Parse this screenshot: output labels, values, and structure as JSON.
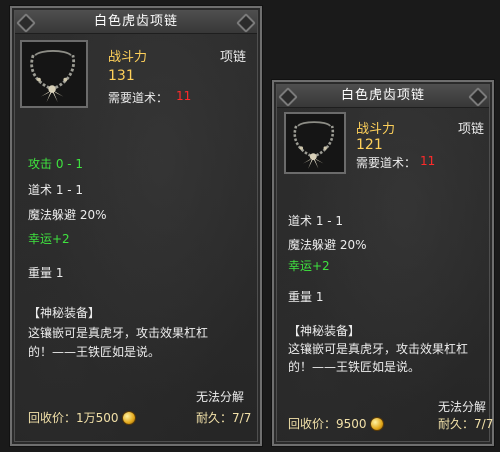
{
  "panel_left": {
    "title": "白色虎齿项链",
    "power_label": "战斗力",
    "power_value": "131",
    "item_type": "项链",
    "req_label": "需要道术：",
    "req_value": "11",
    "stats": {
      "attack": "攻击 0 - 1",
      "taoism": "道术 1 - 1",
      "magic_dodge": "魔法躲避 20%",
      "luck": "幸运+2",
      "weight": "重量 1"
    },
    "desc_title": "【神秘装备】",
    "desc_line1": "这镶嵌可是真虎牙，攻击效果杠杠",
    "desc_line2": "的！——王铁匠如是说。",
    "undecomposable": "无法分解",
    "recycle_label": "回收价：",
    "recycle_value": "1万500",
    "durability_label": "耐久：",
    "durability_value": "7/7"
  },
  "panel_right": {
    "title": "白色虎齿项链",
    "power_label": "战斗力",
    "power_value": "121",
    "item_type": "项链",
    "req_label": "需要道术：",
    "req_value": "11",
    "stats": {
      "taoism": "道术 1 - 1",
      "magic_dodge": "魔法躲避 20%",
      "luck": "幸运+2",
      "weight": "重量 1"
    },
    "desc_title": "【神秘装备】",
    "desc_line1": "这镶嵌可是真虎牙，攻击效果杠杠",
    "desc_line2": "的！——王铁匠如是说。",
    "undecomposable": "无法分解",
    "recycle_label": "回收价：",
    "recycle_value": "9500",
    "durability_label": "耐久：",
    "durability_value": "7/7"
  },
  "icons": {
    "item": "tiger-tooth-necklace-icon",
    "coin": "gold-coin-icon"
  },
  "colors": {
    "title_text": "#ffffff",
    "gold_text": "#ffd15a",
    "requirement_red": "#ff2a2a",
    "attribute_green": "#3fe33f"
  }
}
